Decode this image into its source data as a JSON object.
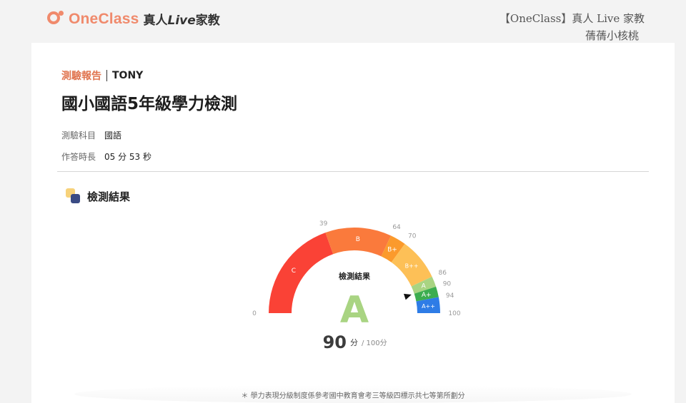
{
  "brand": {
    "name": "OneClass",
    "tagline_prefix": "真人",
    "tagline_italic": "Live",
    "tagline_suffix": "家教"
  },
  "watermark": {
    "line1": "【OneClass】真人 Live 家教",
    "line2": "蒨蒨小核桃"
  },
  "report": {
    "tag": "測驗報告",
    "student": "TONY",
    "title": "國小國語5年級學力檢測",
    "subject_label": "測驗科目",
    "subject_value": "國語",
    "duration_label": "作答時長",
    "duration_value": "05 分 53 秒"
  },
  "result": {
    "section_title": "檢測結果",
    "gauge_caption": "檢測結果",
    "grade": "A",
    "score": "90",
    "score_unit": "分",
    "total": "/ 100分",
    "score_value": 90,
    "max": 100,
    "bands": [
      {
        "label": "C",
        "from": 0,
        "to": 39,
        "color": "#fa4236"
      },
      {
        "label": "B",
        "from": 39,
        "to": 64,
        "color": "#fa7a3c"
      },
      {
        "label": "B+",
        "from": 64,
        "to": 70,
        "color": "#fb9a2c"
      },
      {
        "label": "B++",
        "from": 70,
        "to": 86,
        "color": "#fdc057"
      },
      {
        "label": "A",
        "from": 86,
        "to": 90,
        "color": "#a9d482"
      },
      {
        "label": "A+",
        "from": 90,
        "to": 94,
        "color": "#3cad4f"
      },
      {
        "label": "A++",
        "from": 94,
        "to": 100,
        "color": "#2e7ce6"
      }
    ],
    "ticks": [
      "0",
      "39",
      "64",
      "70",
      "86",
      "90",
      "94",
      "100"
    ],
    "grade_color": "#a9d482"
  },
  "footnote": "＊ 學力表現分級制度係參考國中教育會考三等級四標示共七等第所劃分"
}
